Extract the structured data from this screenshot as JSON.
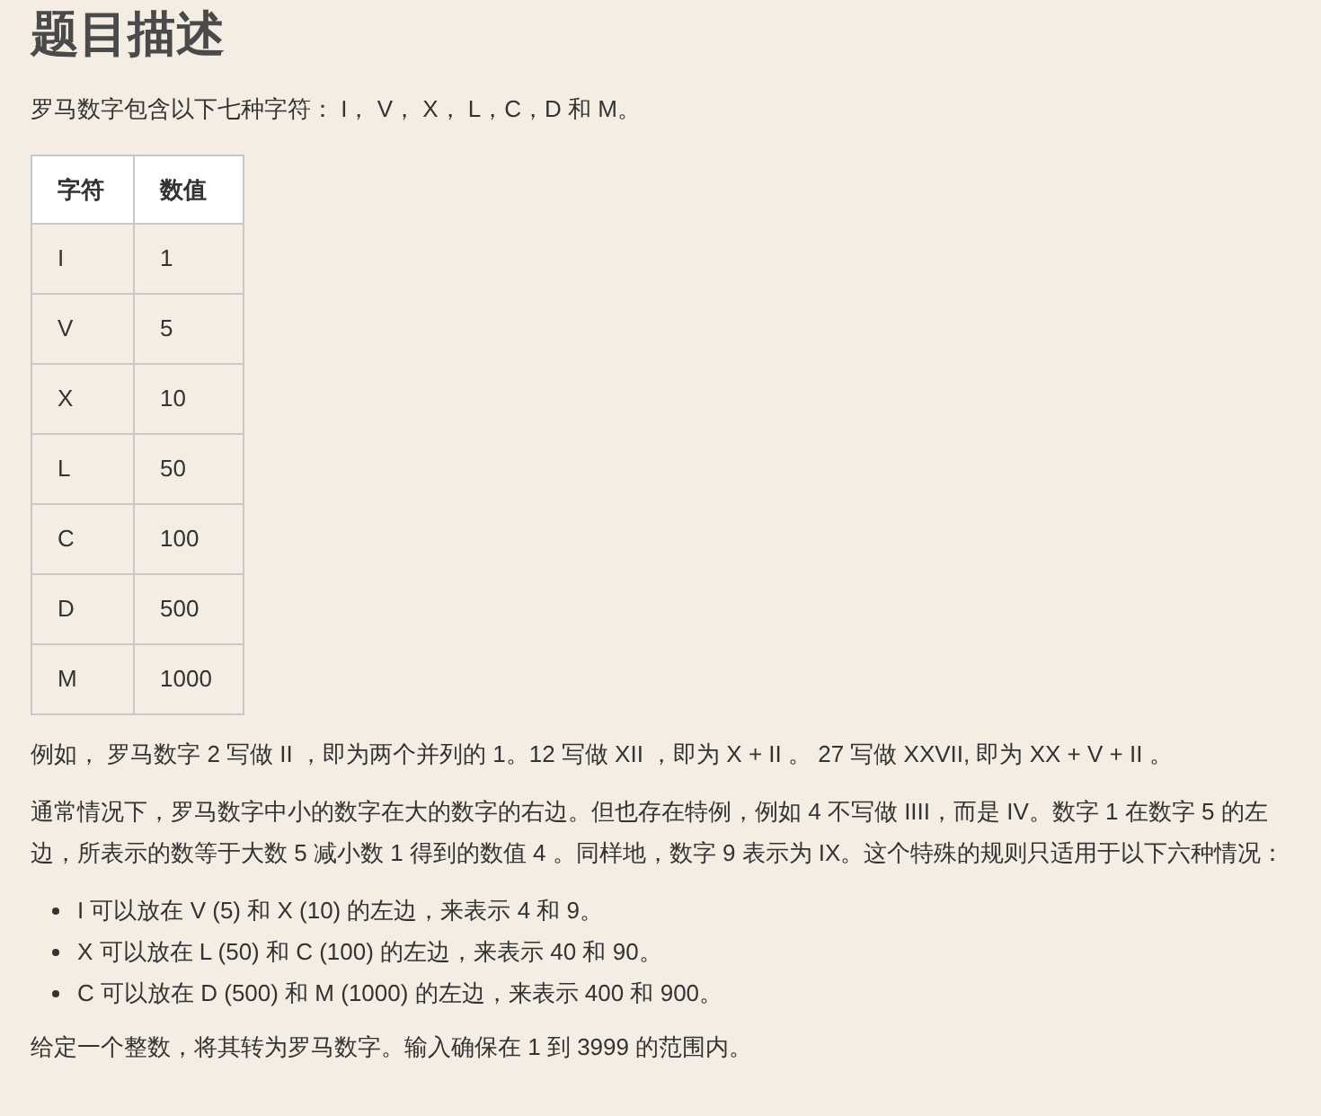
{
  "heading": "题目描述",
  "intro": "罗马数字包含以下七种字符： I， V， X， L，C，D 和 M。",
  "table": {
    "columns": [
      "字符",
      "数值"
    ],
    "rows": [
      [
        "I",
        "1"
      ],
      [
        "V",
        "5"
      ],
      [
        "X",
        "10"
      ],
      [
        "L",
        "50"
      ],
      [
        "C",
        "100"
      ],
      [
        "D",
        "500"
      ],
      [
        "M",
        "1000"
      ]
    ]
  },
  "paragraphs": [
    "例如， 罗马数字 2 写做 II ，即为两个并列的 1。12 写做 XII ，即为 X + II 。 27 写做 XXVII, 即为 XX + V + II 。",
    "通常情况下，罗马数字中小的数字在大的数字的右边。但也存在特例，例如 4 不写做 IIII，而是 IV。数字 1 在数字 5 的左边，所表示的数等于大数 5 减小数 1 得到的数值 4 。同样地，数字 9 表示为 IX。这个特殊的规则只适用于以下六种情况："
  ],
  "bullets": [
    "I 可以放在 V (5) 和 X (10) 的左边，来表示 4 和 9。",
    "X 可以放在 L (50) 和 C (100) 的左边，来表示 40 和 90。",
    "C 可以放在 D (500) 和 M (1000) 的左边，来表示 400 和 900。"
  ],
  "closing": "给定一个整数，将其转为罗马数字。输入确保在 1 到 3999 的范围内。"
}
